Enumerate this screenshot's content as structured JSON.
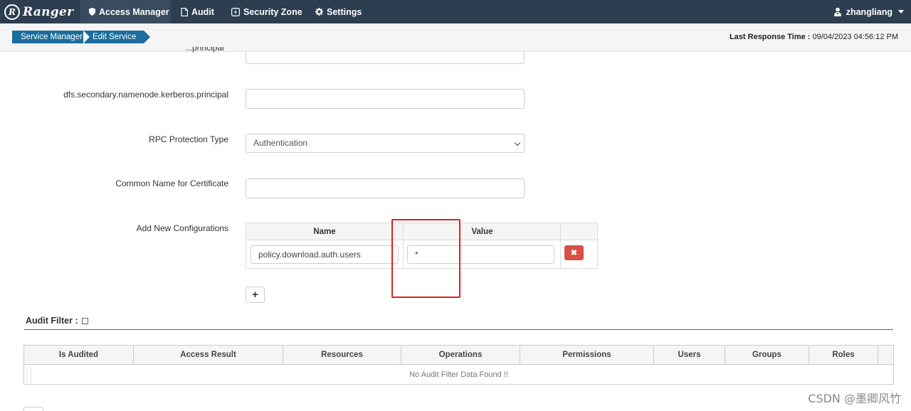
{
  "brand": {
    "name": "Ranger",
    "logo_letter": "R"
  },
  "nav": {
    "items": [
      {
        "label": "Access Manager",
        "icon": "shield-icon"
      },
      {
        "label": "Audit",
        "icon": "file-icon"
      },
      {
        "label": "Security Zone",
        "icon": "zone-bolt-icon"
      },
      {
        "label": "Settings",
        "icon": "gear-icon"
      }
    ],
    "user": "zhangliang"
  },
  "breadcrumb": [
    "Service Manager",
    "Edit Service"
  ],
  "last_response": {
    "label": "Last Response Time :",
    "value": "09/04/2023 04:56:12 PM"
  },
  "form": {
    "partial_label": "...principal",
    "secondary_label": "dfs.secondary.namenode.kerberos.principal",
    "secondary_value": "",
    "rpc_label": "RPC Protection Type",
    "rpc_value": "Authentication",
    "common_name_label": "Common Name for Certificate",
    "common_name_value": "",
    "add_config_label": "Add New Configurations"
  },
  "config_table": {
    "headers": {
      "name": "Name",
      "value": "Value"
    },
    "rows": [
      {
        "name": "policy.download.auth.users",
        "value": "*"
      }
    ],
    "delete_icon": "✖",
    "add_icon": "+"
  },
  "audit_filter": {
    "title": "Audit Filter :",
    "columns": [
      "Is Audited",
      "Access Result",
      "Resources",
      "Operations",
      "Permissions",
      "Users",
      "Groups",
      "Roles"
    ],
    "empty_text": "No Audit Filter Data Found !!"
  },
  "watermark": "CSDN @墨卿风竹",
  "colors": {
    "navbar": "#2c3e50",
    "accent": "#1b6d9c",
    "danger": "#da4f49",
    "highlight": "#e02020"
  }
}
